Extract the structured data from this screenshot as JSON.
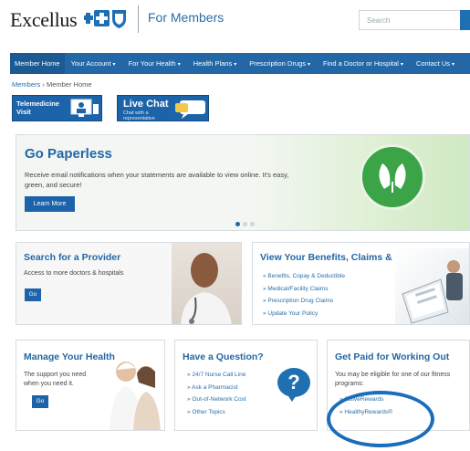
{
  "header": {
    "logo_text": "Excellus",
    "tagline": "For Members",
    "search_placeholder": "Search"
  },
  "nav": {
    "items": [
      {
        "label": "Member Home",
        "active": true,
        "dropdown": false
      },
      {
        "label": "Your Account",
        "dropdown": true
      },
      {
        "label": "For Your Health",
        "dropdown": true
      },
      {
        "label": "Health Plans",
        "dropdown": true
      },
      {
        "label": "Prescription Drugs",
        "dropdown": true
      },
      {
        "label": "Find a Doctor or Hospital",
        "dropdown": true
      },
      {
        "label": "Contact Us",
        "dropdown": true
      }
    ],
    "caret": "▾"
  },
  "breadcrumb": {
    "root": "Members",
    "separator": "›",
    "current": "Member Home"
  },
  "quick": {
    "telemedicine_line1": "Telemedicine",
    "telemedicine_line2": "Visit",
    "chat_title": "Live Chat",
    "chat_sub1": "Chat with a",
    "chat_sub2": "representative"
  },
  "hero": {
    "title": "Go Paperless",
    "text": "Receive email notifications when your statements are available to view online. It's easy, green, and secure!",
    "button": "Learn More",
    "slide_count": 3,
    "active_slide": 1
  },
  "provider": {
    "title": "Search for a Provider",
    "text": "Access to more doctors & hospitals",
    "button": "Go"
  },
  "benefits": {
    "title": "View Your Benefits, Claims & More",
    "links": [
      "» Benefits, Copay & Deductible",
      "» Medical/Facility Claims",
      "» Prescription Drug Claims",
      "» Update Your Policy"
    ]
  },
  "manage": {
    "title": "Manage Your Health",
    "line1": "The support you need",
    "line2": "when you need it.",
    "button": "Go"
  },
  "question": {
    "title": "Have a Question?",
    "links": [
      "» 24/7 Nurse Call Line",
      "» Ask a Pharmacist",
      "» Out-of-Network Cost",
      "» Other Topics"
    ],
    "bubble_glyph": "?"
  },
  "getpaid": {
    "title": "Get Paid for Working Out",
    "text_line1": "You may be eligible for one of our fitness",
    "text_line2": "programs:",
    "links": [
      "» ActiveRewards",
      "» HealthyRewards®"
    ]
  },
  "colors": {
    "brand_blue": "#2367a6",
    "nav_bg": "#2367a6",
    "highlight_oval": "#1a6dbb",
    "leaf_green": "#3aa447"
  }
}
